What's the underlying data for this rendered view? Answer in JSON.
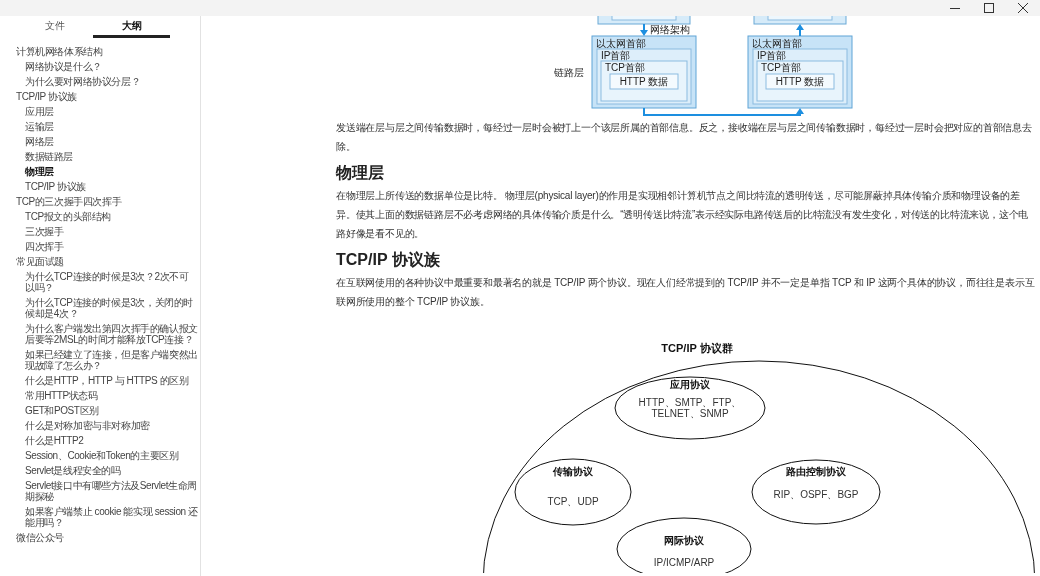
{
  "title_bar": {
    "controls": [
      {
        "kind": "minimize"
      },
      {
        "kind": "maximize"
      },
      {
        "kind": "close"
      }
    ]
  },
  "sidebar": {
    "tabs": [
      {
        "label": "文件",
        "selected": false
      },
      {
        "label": "大纲",
        "selected": true
      }
    ],
    "outline": [
      {
        "label": "计算机网络体系结构",
        "selected": false,
        "children": [
          {
            "label": "网络协议是什么？",
            "selected": false
          },
          {
            "label": "为什么要对网络协议分层？",
            "selected": false
          }
        ]
      },
      {
        "label": "TCP/IP 协议族",
        "selected": false,
        "children": [
          {
            "label": "应用层",
            "selected": false
          },
          {
            "label": "运输层",
            "selected": false
          },
          {
            "label": "网络层",
            "selected": false
          },
          {
            "label": "数据链路层",
            "selected": false
          },
          {
            "label": "物理层",
            "selected": true
          },
          {
            "label": "TCP/IP 协议族",
            "selected": false
          }
        ]
      },
      {
        "label": "TCP的三次握手四次挥手",
        "selected": false,
        "children": [
          {
            "label": "TCP报文的头部结构",
            "selected": false
          },
          {
            "label": "三次握手",
            "selected": false
          },
          {
            "label": "四次挥手",
            "selected": false
          }
        ]
      },
      {
        "label": "常见面试题",
        "selected": false,
        "children": [
          {
            "label": "为什么TCP连接的时候是3次？2次不可以吗？",
            "selected": false
          },
          {
            "label": "为什么TCP连接的时候是3次，关闭的时候却是4次？",
            "selected": false
          },
          {
            "label": "为什么客户端发出第四次挥手的确认报文后要等2MSL的时间才能释放TCP连接？",
            "selected": false
          },
          {
            "label": "如果已经建立了连接，但是客户端突然出现故障了怎么办？",
            "selected": false
          },
          {
            "label": "什么是HTTP，HTTP 与 HTTPS 的区别",
            "selected": false
          },
          {
            "label": "常用HTTP状态码",
            "selected": false
          },
          {
            "label": "GET和POST区别",
            "selected": false
          },
          {
            "label": "什么是对称加密与非对称加密",
            "selected": false
          },
          {
            "label": "什么是HTTP2",
            "selected": false
          },
          {
            "label": "Session、Cookie和Token的主要区别",
            "selected": false
          },
          {
            "label": "Servlet是线程安全的吗",
            "selected": false
          },
          {
            "label": "Servlet接口中有哪些方法及Servlet生命周期探秘",
            "selected": false
          },
          {
            "label": "如果客户端禁止 cookie 能实现 session 还能用吗？",
            "selected": false
          }
        ]
      },
      {
        "label": "微信公众号",
        "selected": false
      }
    ]
  },
  "article": {
    "figure": {
      "arrow_label": "网络架构",
      "layer_label": "链路层",
      "stacks": [
        {
          "frame": "以太网首部",
          "ip": "IP首部",
          "tcp": "TCP首部",
          "data": "HTTP 数据"
        },
        {
          "frame": "以太网首部",
          "ip": "IP首部",
          "tcp": "TCP首部",
          "data": "HTTP 数据"
        }
      ]
    },
    "blocks": [
      {
        "kind": "paragraph",
        "text": "发送端在层与层之间传输数据时，每经过一层时会被打上一个该层所属的首部信息。反之，接收端在层与层之间传输数据时，每经过一层时会把对应的首部信息去除。"
      },
      {
        "kind": "heading",
        "text": "物理层"
      },
      {
        "kind": "paragraph",
        "text": "在物理层上所传送的数据单位是比特。 物理层(physical layer)的作用是实现相邻计算机节点之间比特流的透明传送，尽可能屏蔽掉具体传输介质和物理设备的差异。使其上面的数据链路层不必考虑网络的具体传输介质是什么。“透明传送比特流”表示经实际电路传送后的比特流没有发生变化，对传送的比特流来说，这个电路好像是看不见的。"
      },
      {
        "kind": "heading",
        "text": "TCP/IP 协议族"
      },
      {
        "kind": "paragraph",
        "text": "在互联网使用的各种协议中最重要和最著名的就是 TCP/IP 两个协议。现在人们经常提到的 TCP/IP 并不一定是单指 TCP 和 IP 这两个具体的协议，而往往是表示互联网所使用的整个 TCP/IP 协议族。"
      }
    ],
    "diagram": {
      "title": "TCP/IP 协议群",
      "groups": [
        {
          "name": "应用协议",
          "protocols": [
            "HTTP、SMTP、FTP、",
            "TELNET、SNMP"
          ]
        },
        {
          "name": "传输协议",
          "protocols": [
            "TCP、UDP"
          ]
        },
        {
          "name": "路由控制协议",
          "protocols": [
            "RIP、OSPF、BGP"
          ]
        },
        {
          "name": "网际协议",
          "protocols": [
            "IP/ICMP/ARP"
          ]
        }
      ]
    }
  }
}
